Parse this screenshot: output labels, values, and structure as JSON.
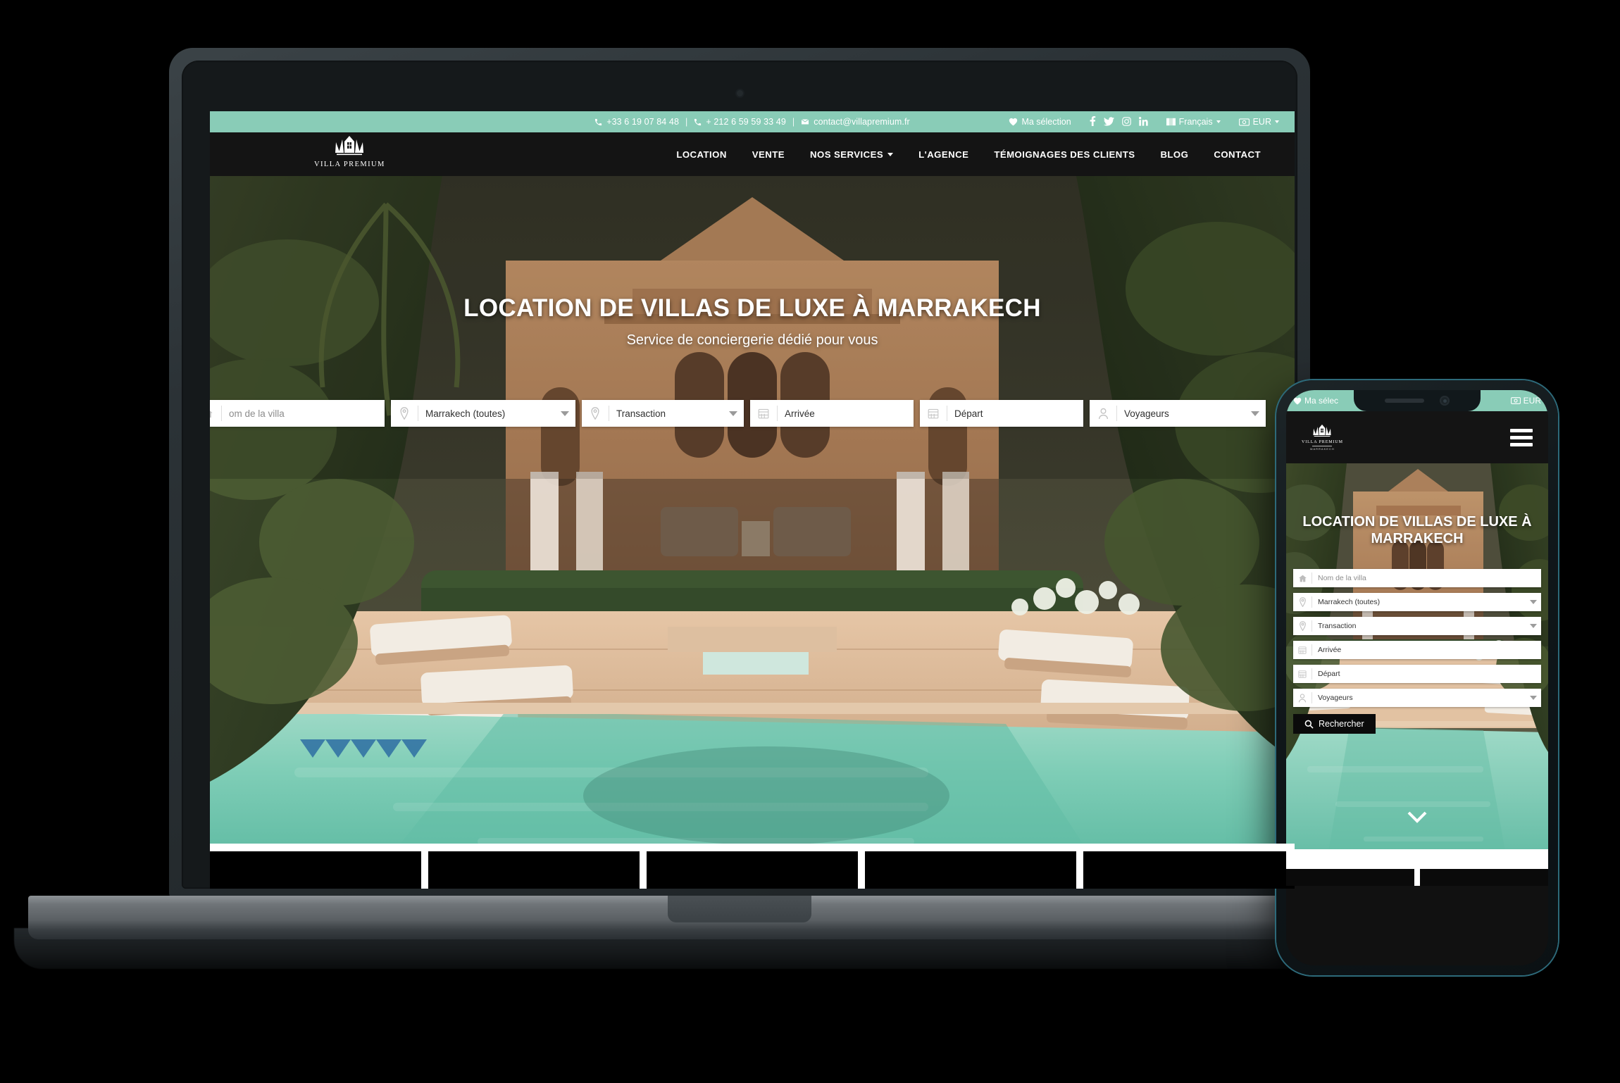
{
  "site": {
    "topbar": {
      "phone_1": "+33 6 19 07 84 48",
      "sep_1": "|",
      "phone_2": "+ 212 6 59 59 33 49",
      "sep_2": "|",
      "email": "contact@villapremium.fr",
      "selection_label": "Ma sélection",
      "language_label": "Français",
      "currency_label": "EUR",
      "socials": [
        "facebook-icon",
        "twitter-icon",
        "instagram-icon",
        "linkedin-icon"
      ]
    },
    "brand": {
      "logo_icon": "crown-villa-logo-icon",
      "name": "VILLA PREMIUM"
    },
    "nav": [
      {
        "label": "LOCATION",
        "has_caret": false
      },
      {
        "label": "VENTE",
        "has_caret": false
      },
      {
        "label": "NOS SERVICES",
        "has_caret": true
      },
      {
        "label": "L'AGENCE",
        "has_caret": false
      },
      {
        "label": "TÉMOIGNAGES DES CLIENTS",
        "has_caret": false
      },
      {
        "label": "BLOG",
        "has_caret": false
      },
      {
        "label": "CONTACT",
        "has_caret": false
      }
    ],
    "hero": {
      "title": "LOCATION DE VILLAS DE LUXE À MARRAKECH",
      "subtitle": "Service de conciergerie dédié pour vous"
    },
    "search": {
      "villa_name_placeholder": "Nom de la villa",
      "villa_name_visible": "om de la villa",
      "city_value": "Marrakech (toutes)",
      "transaction_value": "Transaction",
      "arrival_value": "Arrivée",
      "departure_value": "Départ",
      "travellers_value": "Voyageurs",
      "icons": {
        "villa": "home-icon",
        "city": "map-pin-icon",
        "transaction": "map-pin-icon",
        "arrival": "calendar-icon",
        "departure": "calendar-icon",
        "travellers": "user-icon"
      }
    }
  },
  "mobile": {
    "topbar": {
      "selection_label": "Ma sélec",
      "currency_label": "EUR"
    },
    "brand": {
      "name": "VILLA PREMIUM",
      "sub": "MARRAKECH"
    },
    "menu_icon": "hamburger-menu-icon",
    "hero": {
      "title": "LOCATION DE VILLAS DE LUXE À MARRAKECH"
    },
    "search": {
      "villa_name_placeholder": "Nom de la villa",
      "city_value": "Marrakech (toutes)",
      "transaction_value": "Transaction",
      "arrival_value": "Arrivée",
      "departure_value": "Départ",
      "travellers_value": "Voyageurs",
      "search_button_label": "Rechercher",
      "search_button_icon": "search-icon"
    },
    "scroll_icon": "chevron-down-icon"
  },
  "colors": {
    "accent_green": "#89ccb7",
    "nav_dark": "#141414",
    "button_black": "#0b0b0b",
    "text_white": "#ffffff"
  }
}
